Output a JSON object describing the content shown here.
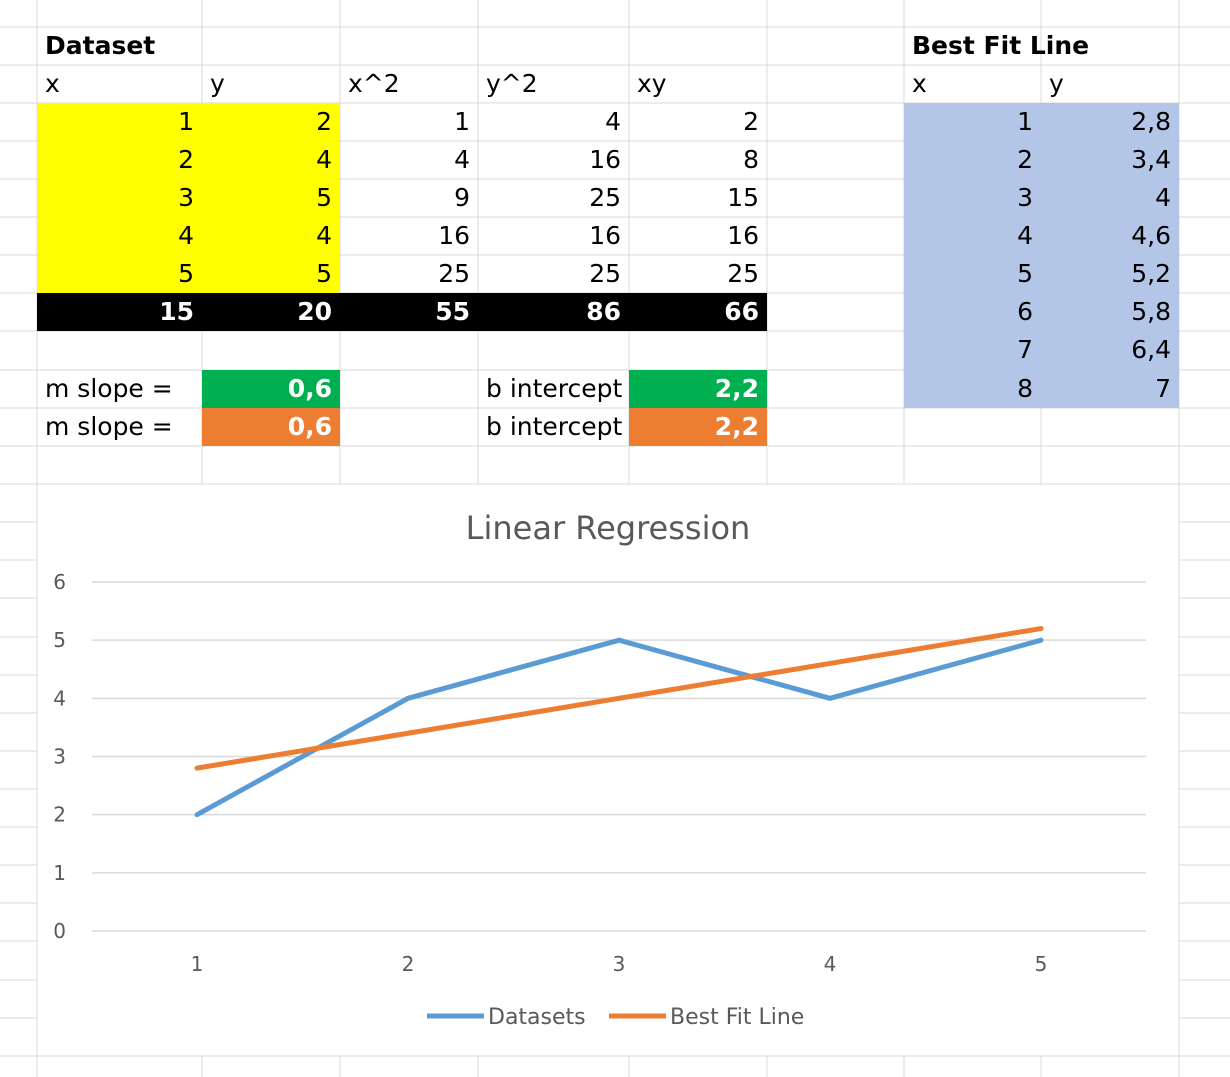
{
  "sheet": {
    "dataset_title": "Dataset",
    "best_fit_title": "Best Fit Line",
    "headers": [
      "x",
      "y",
      "x^2",
      "y^2",
      "xy"
    ],
    "rows": [
      [
        "1",
        "2",
        "1",
        "4",
        "2"
      ],
      [
        "2",
        "4",
        "4",
        "16",
        "8"
      ],
      [
        "3",
        "5",
        "9",
        "25",
        "15"
      ],
      [
        "4",
        "4",
        "16",
        "16",
        "16"
      ],
      [
        "5",
        "5",
        "25",
        "25",
        "25"
      ]
    ],
    "totals": [
      "15",
      "20",
      "55",
      "86",
      "66"
    ],
    "slope_label": "m slope =",
    "intercept_label": "b intercept",
    "slope_green": "0,6",
    "intercept_green": "2,2",
    "slope_orange": "0,6",
    "intercept_orange": "2,2",
    "best_fit_headers": [
      "x",
      "y"
    ],
    "best_fit_rows": [
      [
        "1",
        "2,8"
      ],
      [
        "2",
        "3,4"
      ],
      [
        "3",
        "4"
      ],
      [
        "4",
        "4,6"
      ],
      [
        "5",
        "5,2"
      ],
      [
        "6",
        "5,8"
      ],
      [
        "7",
        "6,4"
      ],
      [
        "8",
        "7"
      ]
    ],
    "colors": {
      "dataset_fill": "#ffff00",
      "totals_fill": "#000000",
      "green_fill": "#00b050",
      "orange_fill": "#ed7d31",
      "best_fit_fill": "#b4c6e7",
      "gridline": "#d9d9d9"
    }
  },
  "chart_data": {
    "type": "line",
    "title": "Linear Regression",
    "categories": [
      "1",
      "2",
      "3",
      "4",
      "5"
    ],
    "series": [
      {
        "name": "Datasets",
        "values": [
          2,
          4,
          5,
          4,
          5
        ],
        "color": "#5b9bd5"
      },
      {
        "name": "Best Fit Line",
        "values": [
          2.8,
          3.4,
          4,
          4.6,
          5.2
        ],
        "color": "#ed7d31"
      }
    ],
    "ylim": [
      0,
      6
    ],
    "yticks": [
      0,
      1,
      2,
      3,
      4,
      5,
      6
    ],
    "grid": true,
    "legend": "bottom"
  }
}
